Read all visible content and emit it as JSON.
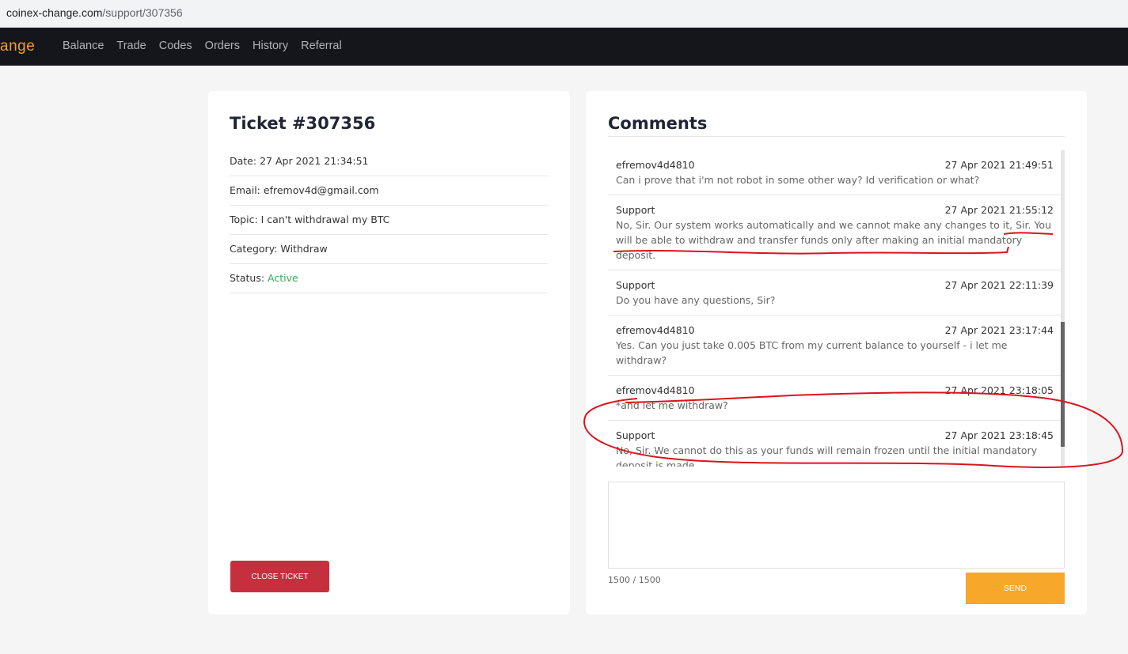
{
  "browser": {
    "domain": "coinex-change.com",
    "path": "/support/307356"
  },
  "nav": {
    "brand": "ange",
    "items": [
      "Balance",
      "Trade",
      "Codes",
      "Orders",
      "History",
      "Referral"
    ]
  },
  "ticket": {
    "title": "Ticket #307356",
    "date_label": "Date:",
    "date": "27 Apr 2021 21:34:51",
    "email_label": "Email:",
    "email": "efremov4d@gmail.com",
    "topic_label": "Topic:",
    "topic": "I can't withdrawal my BTC",
    "category_label": "Category:",
    "category": "Withdraw",
    "status_label": "Status:",
    "status": "Active",
    "close_label": "CLOSE TICKET"
  },
  "comments": {
    "title": "Comments",
    "items": [
      {
        "author": "efremov4d4810",
        "time": "27 Apr 2021 21:49:51",
        "text": "Can i prove that i'm not robot in some other way? Id verification or what?"
      },
      {
        "author": "Support",
        "time": "27 Apr 2021 21:55:12",
        "text": "No, Sir. Our system works automatically and we cannot make any changes to it, Sir. You will be able to withdraw and transfer funds only after making an initial mandatory deposit."
      },
      {
        "author": "Support",
        "time": "27 Apr 2021 22:11:39",
        "text": "Do you have any questions, Sir?"
      },
      {
        "author": "efremov4d4810",
        "time": "27 Apr 2021 23:17:44",
        "text": "Yes. Can you just take 0.005 BTC from my current balance to yourself - i let me withdraw?"
      },
      {
        "author": "efremov4d4810",
        "time": "27 Apr 2021 23:18:05",
        "text": "*and let me withdraw?"
      },
      {
        "author": "Support",
        "time": "27 Apr 2021 23:18:45",
        "text": "No, Sir. We cannot do this as your funds will remain frozen until the initial mandatory deposit is made."
      }
    ],
    "counter": "1500 / 1500",
    "send_label": "SEND"
  },
  "colors": {
    "nav_bg": "#14161b",
    "brand": "#f0a030",
    "close_button": "#c62f3e",
    "send_button": "#f7a72a",
    "status_active": "#3aa757",
    "annotation": "#d9141c"
  }
}
